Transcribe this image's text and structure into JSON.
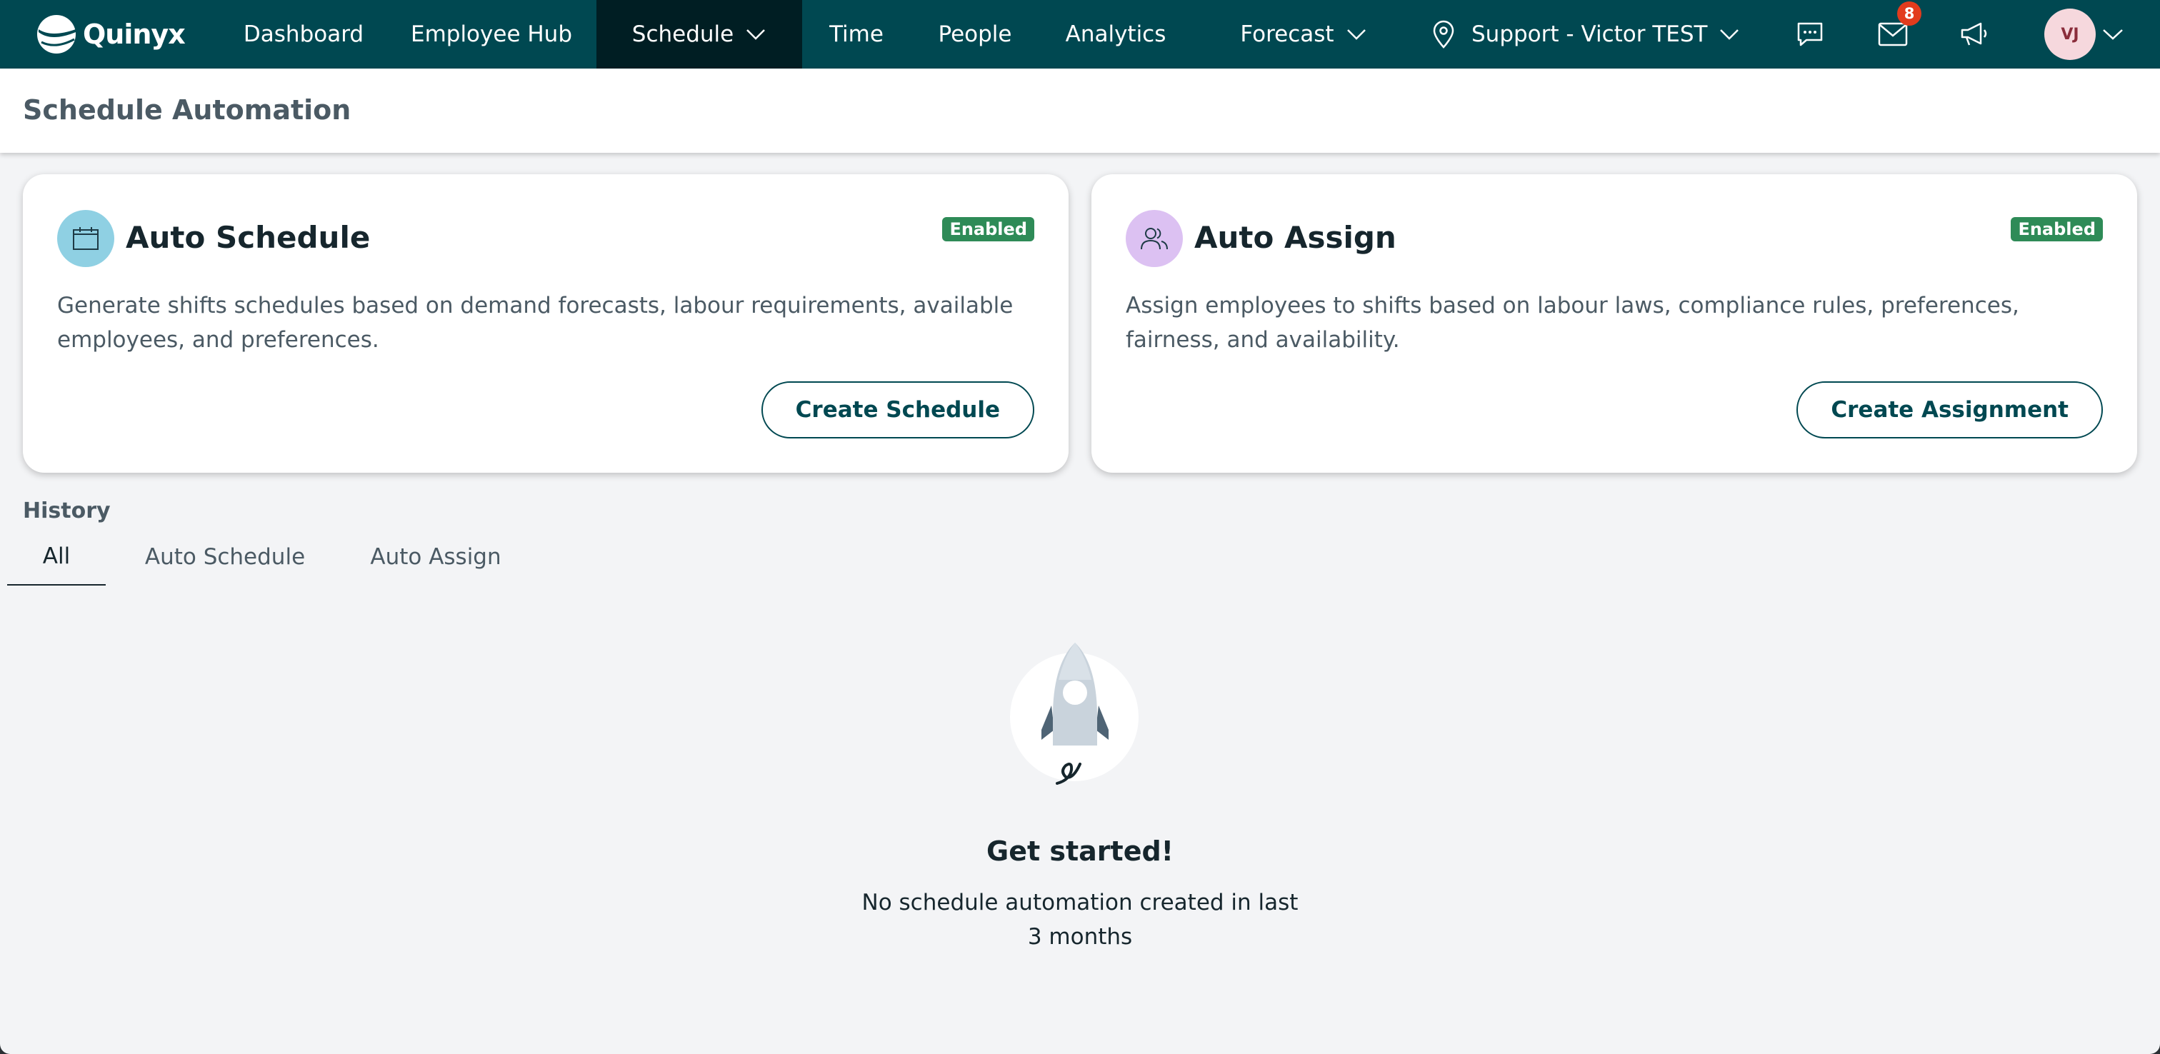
{
  "nav": {
    "brand": "Quinyx",
    "items": [
      {
        "label": "Dashboard"
      },
      {
        "label": "Employee Hub"
      },
      {
        "label": "Schedule"
      },
      {
        "label": "Time"
      },
      {
        "label": "People"
      },
      {
        "label": "Analytics"
      },
      {
        "label": "Forecast"
      }
    ],
    "active_item": "Schedule",
    "location": "Support - Victor TEST",
    "messages_badge": "8",
    "avatar_initials": "VJ",
    "icons": [
      "chat-icon",
      "mail-icon",
      "megaphone-icon",
      "location-pin-icon"
    ]
  },
  "page": {
    "title": "Schedule Automation"
  },
  "cards": [
    {
      "title": "Auto Schedule",
      "status": "Enabled",
      "description": "Generate shifts schedules based on demand forecasts, labour requirements, available employees, and preferences.",
      "button": "Create Schedule",
      "icon": "calendar-icon",
      "icon_bg": "#8fd0e3"
    },
    {
      "title": "Auto Assign",
      "status": "Enabled",
      "description": "Assign employees to shifts based on labour laws, compliance rules, preferences, fairness, and availability.",
      "button": "Create Assignment",
      "icon": "users-icon",
      "icon_bg": "#dcc1f2"
    }
  ],
  "history": {
    "label": "History",
    "tabs": [
      {
        "label": "All"
      },
      {
        "label": "Auto Schedule"
      },
      {
        "label": "Auto Assign"
      }
    ],
    "active_tab": "All"
  },
  "empty_state": {
    "title": "Get started!",
    "text": "No schedule automation created in last 3 months",
    "icon": "rocket-icon"
  },
  "colors": {
    "nav_bg": "#004851",
    "nav_active": "#001e23",
    "enabled_badge": "#2e8b57",
    "notification_badge": "#e23b1d",
    "page_bg": "#f3f4f6"
  }
}
